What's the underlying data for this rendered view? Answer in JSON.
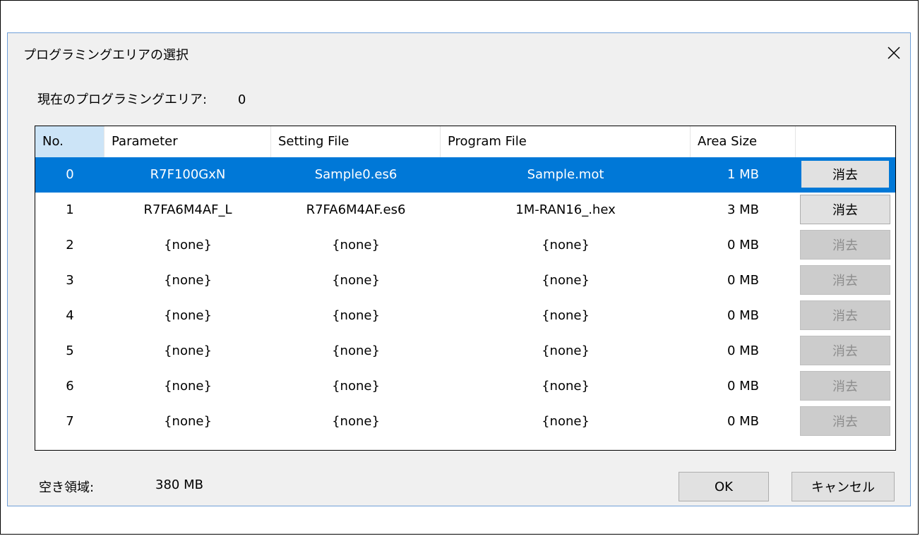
{
  "dialog": {
    "title": "プログラミングエリアの選択",
    "current_area_label": "現在のプログラミングエリア:",
    "current_area_value": "0"
  },
  "table": {
    "headers": [
      "No.",
      "Parameter",
      "Setting File",
      "Program File",
      "Area Size",
      ""
    ],
    "rows": [
      {
        "no": "0",
        "parameter": "R7F100GxN",
        "setting_file": "Sample0.es6",
        "program_file": "Sample.mot",
        "area_size": "1 MB",
        "button": "消去",
        "enabled": true,
        "selected": true
      },
      {
        "no": "1",
        "parameter": "R7FA6M4AF_L",
        "setting_file": "R7FA6M4AF.es6",
        "program_file": "1M-RAN16_.hex",
        "area_size": "3 MB",
        "button": "消去",
        "enabled": true,
        "selected": false
      },
      {
        "no": "2",
        "parameter": "{none}",
        "setting_file": "{none}",
        "program_file": "{none}",
        "area_size": "0 MB",
        "button": "消去",
        "enabled": false,
        "selected": false
      },
      {
        "no": "3",
        "parameter": "{none}",
        "setting_file": "{none}",
        "program_file": "{none}",
        "area_size": "0 MB",
        "button": "消去",
        "enabled": false,
        "selected": false
      },
      {
        "no": "4",
        "parameter": "{none}",
        "setting_file": "{none}",
        "program_file": "{none}",
        "area_size": "0 MB",
        "button": "消去",
        "enabled": false,
        "selected": false
      },
      {
        "no": "5",
        "parameter": "{none}",
        "setting_file": "{none}",
        "program_file": "{none}",
        "area_size": "0 MB",
        "button": "消去",
        "enabled": false,
        "selected": false
      },
      {
        "no": "6",
        "parameter": "{none}",
        "setting_file": "{none}",
        "program_file": "{none}",
        "area_size": "0 MB",
        "button": "消去",
        "enabled": false,
        "selected": false
      },
      {
        "no": "7",
        "parameter": "{none}",
        "setting_file": "{none}",
        "program_file": "{none}",
        "area_size": "0 MB",
        "button": "消去",
        "enabled": false,
        "selected": false
      }
    ]
  },
  "footer": {
    "free_space_label": "空き領域:",
    "free_space_value": "380 MB",
    "ok_label": "OK",
    "cancel_label": "キャンセル"
  },
  "colors": {
    "selection": "#0078d7",
    "sorted_header": "#cce4f7",
    "dialog_bg": "#f0f0f0"
  },
  "icons": {
    "close": "close-icon"
  }
}
